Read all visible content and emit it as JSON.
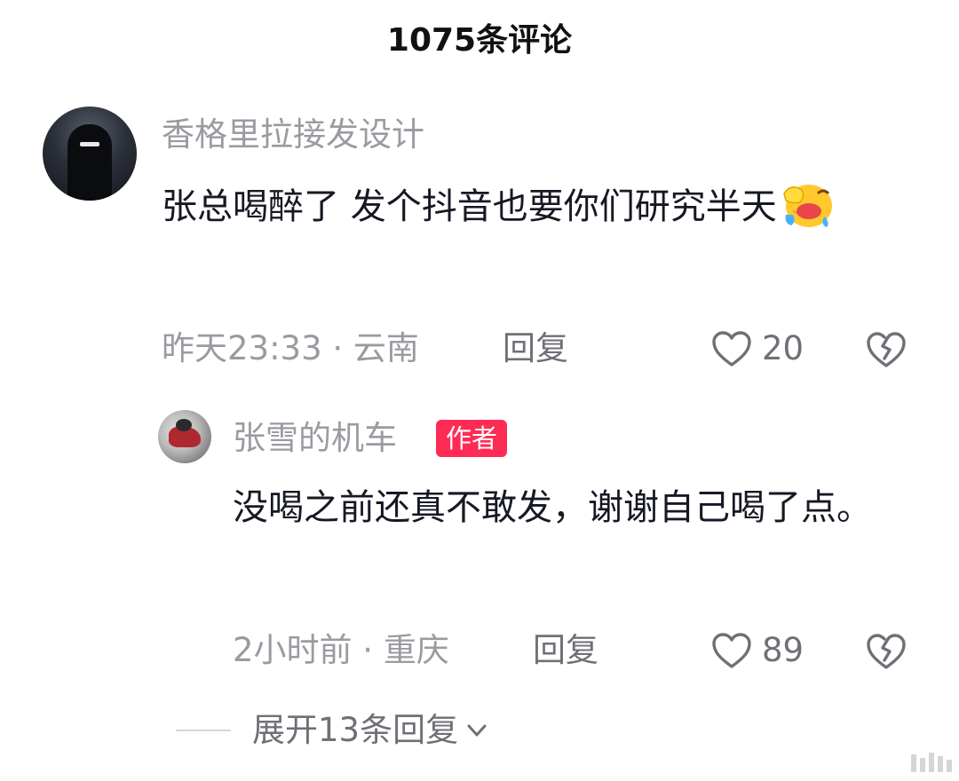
{
  "header": {
    "title": "1075条评论"
  },
  "comments": [
    {
      "username": "香格里拉接发设计",
      "text": "张总喝醉了   发个抖音也要你们研究半天",
      "emoji": "face-with-hand-over-eyes-laughing",
      "time_location": "昨天23:33 · 云南",
      "reply_label": "回复",
      "likes": "20"
    }
  ],
  "reply": {
    "username": "张雪的机车",
    "badge": "作者",
    "text": "没喝之前还真不敢发，谢谢自己喝了点。",
    "time_location": "2小时前 · 重庆",
    "reply_label": "回复",
    "likes": "89"
  },
  "expand": {
    "label": "展开13条回复"
  },
  "colors": {
    "accent": "#fe2c55",
    "muted": "#9a9ba1",
    "text": "#161823"
  }
}
